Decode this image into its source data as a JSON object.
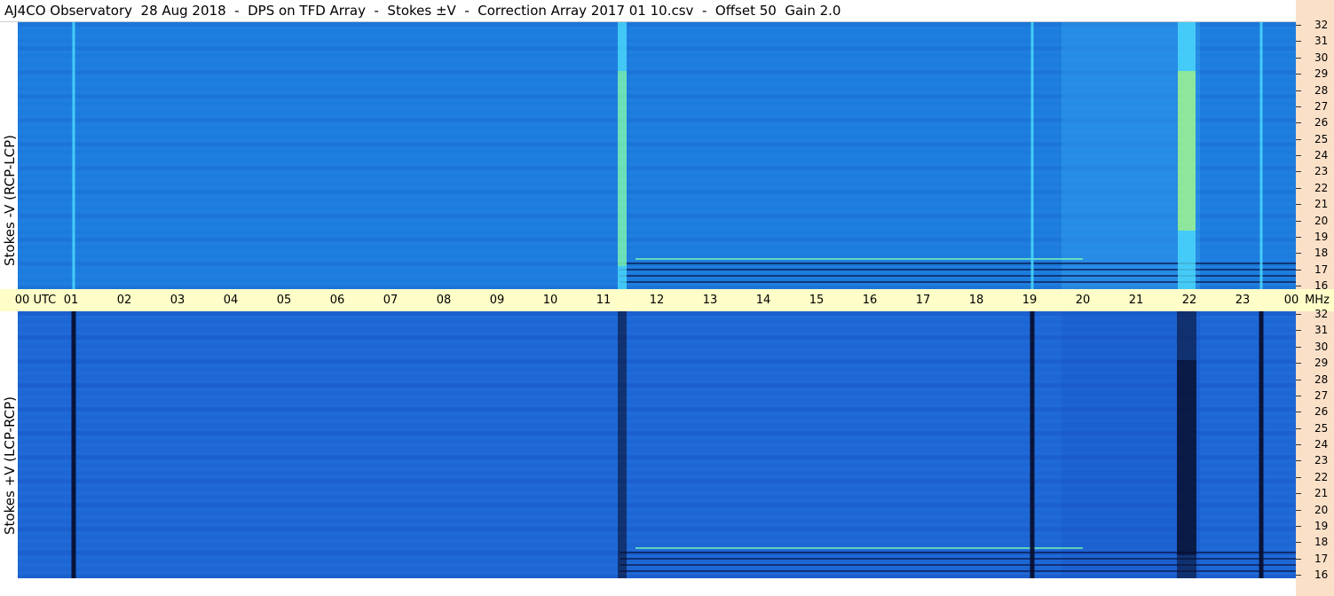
{
  "title": "AJ4CO Observatory  28 Aug 2018  -  DPS on TFD Array  -  Stokes ±V  -  Correction Array 2017 01 10.csv  -  Offset 50  Gain 2.0",
  "chart_data": [
    {
      "type": "heatmap",
      "panel": "top",
      "ylabel": "Stokes -V (RCP-LCP)",
      "x_unit": "UTC",
      "y_unit": "MHz",
      "xlim": [
        0,
        24
      ],
      "ylim": [
        16,
        32
      ],
      "yticks": [
        "32",
        "31",
        "30",
        "29",
        "28",
        "27",
        "26",
        "25",
        "24",
        "23",
        "22",
        "21",
        "20",
        "19",
        "18",
        "17",
        "16"
      ],
      "base_color": "#1f7fe0",
      "bright_color": "#4fe0ff",
      "emission_features": [
        {
          "t": 1.05,
          "kind": "bright-line"
        },
        {
          "t": 11.35,
          "kind": "bright-band"
        },
        {
          "t": 19.05,
          "kind": "bright-line"
        },
        {
          "t": 21.95,
          "kind": "bright-band"
        },
        {
          "t": 23.35,
          "kind": "bright-line"
        }
      ]
    },
    {
      "type": "heatmap",
      "panel": "bottom",
      "ylabel": "Stokes +V (LCP-RCP)",
      "x_unit": "UTC",
      "y_unit": "MHz",
      "xlim": [
        0,
        24
      ],
      "ylim": [
        16,
        32
      ],
      "yticks": [
        "32",
        "31",
        "30",
        "29",
        "28",
        "27",
        "26",
        "25",
        "24",
        "23",
        "22",
        "21",
        "20",
        "19",
        "18",
        "17",
        "16"
      ],
      "base_color": "#1f6ad8",
      "dark_color": "#0a1030",
      "emission_features": [
        {
          "t": 1.05,
          "kind": "dark-line"
        },
        {
          "t": 11.35,
          "kind": "dark-band"
        },
        {
          "t": 19.05,
          "kind": "dark-line"
        },
        {
          "t": 21.95,
          "kind": "dark-band"
        },
        {
          "t": 23.35,
          "kind": "dark-line"
        }
      ]
    }
  ],
  "time_axis": {
    "labels": [
      "00  UTC",
      "01",
      "02",
      "03",
      "04",
      "05",
      "06",
      "07",
      "08",
      "09",
      "10",
      "11",
      "12",
      "13",
      "14",
      "15",
      "16",
      "17",
      "18",
      "19",
      "20",
      "21",
      "22",
      "23",
      "00"
    ],
    "end_unit": "MHz"
  }
}
